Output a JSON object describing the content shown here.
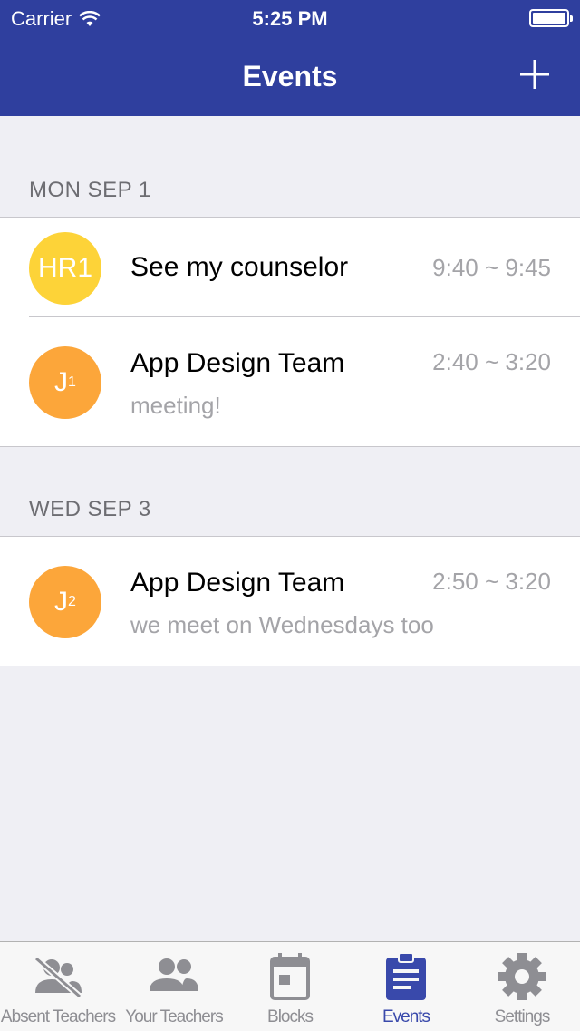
{
  "status_bar": {
    "carrier": "Carrier",
    "time": "5:25 PM"
  },
  "nav": {
    "title": "Events",
    "add_icon": "plus-icon"
  },
  "sections": [
    {
      "header": "MON SEP 1",
      "events": [
        {
          "avatar_text": "HR1",
          "avatar_color": "#fdd338",
          "title": "See my counselor",
          "time": "9:40 ~ 9:45",
          "subtitle": ""
        },
        {
          "avatar_text": "J",
          "avatar_sub": "1",
          "avatar_color": "#fca63a",
          "title": "App Design Team",
          "time": "2:40 ~ 3:20",
          "subtitle": "meeting!"
        }
      ]
    },
    {
      "header": "WED SEP 3",
      "events": [
        {
          "avatar_text": "J",
          "avatar_sub": "2",
          "avatar_color": "#fca63a",
          "title": "App Design Team",
          "time": "2:50 ~ 3:20",
          "subtitle": "we meet on Wednesdays too"
        }
      ]
    }
  ],
  "tabbar": {
    "items": [
      {
        "label": "Absent Teachers",
        "icon": "absent-teachers-icon"
      },
      {
        "label": "Your Teachers",
        "icon": "people-icon"
      },
      {
        "label": "Blocks",
        "icon": "calendar-icon"
      },
      {
        "label": "Events",
        "icon": "clipboard-icon",
        "active": true
      },
      {
        "label": "Settings",
        "icon": "gear-icon"
      }
    ]
  },
  "colors": {
    "nav_bg": "#2f3f9e",
    "active_tab": "#3949ab",
    "inactive_tab": "#8e8e93"
  }
}
